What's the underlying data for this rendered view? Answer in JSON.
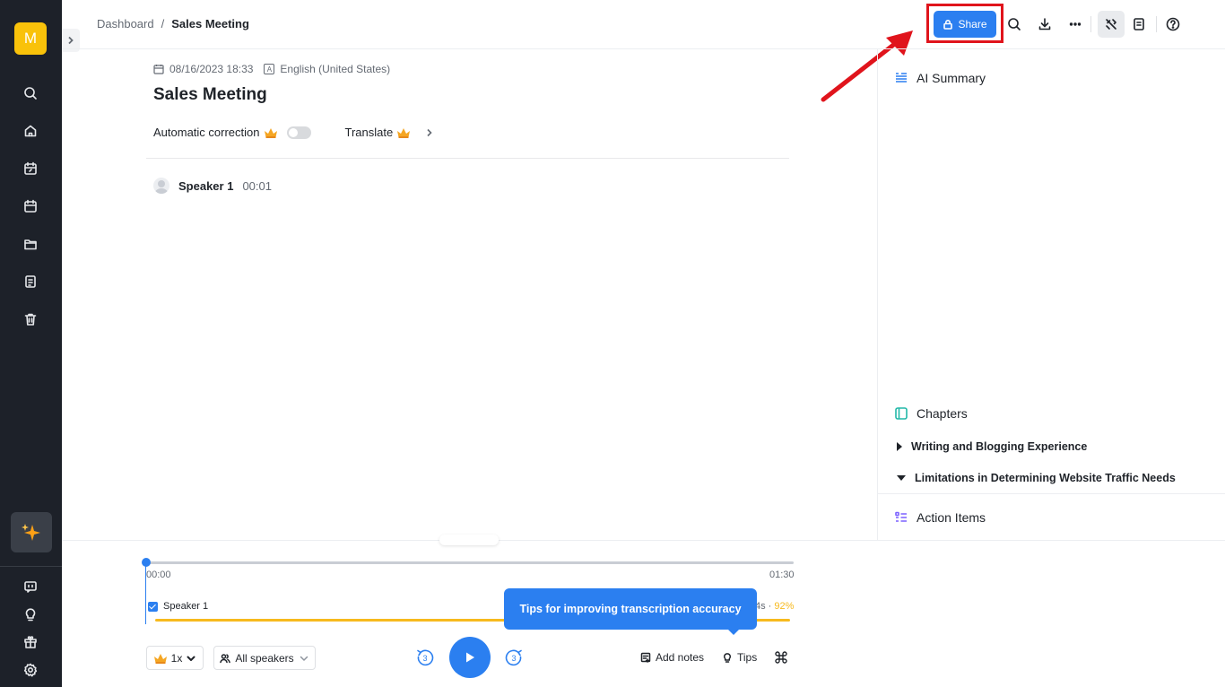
{
  "breadcrumb": {
    "parent": "Dashboard",
    "separator": "/",
    "current": "Sales Meeting"
  },
  "sidebar": {
    "avatar_letter": "M",
    "items": [
      "search-icon",
      "home-icon",
      "calendar-edit-icon",
      "calendar-icon",
      "folder-icon",
      "document-icon",
      "trash-icon"
    ],
    "bottom_items": [
      "feedback-icon",
      "lightbulb-icon",
      "gift-icon",
      "settings-icon"
    ]
  },
  "header": {
    "share_label": "Share",
    "icons": [
      "search-icon",
      "download-icon",
      "more-icon",
      "tools-icon",
      "notes-icon",
      "help-icon"
    ]
  },
  "doc": {
    "date": "08/16/2023 18:33",
    "lang_icon": "A",
    "language": "English (United States)",
    "title": "Sales Meeting",
    "auto_correction_label": "Automatic correction",
    "translate_label": "Translate",
    "speaker": {
      "name": "Speaker 1",
      "time": "00:01"
    }
  },
  "panel": {
    "ai_summary_title": "AI Summary",
    "chapters_title": "Chapters",
    "chapters": [
      {
        "title": "Writing and Blogging Experience",
        "expanded": false
      },
      {
        "title": "Limitations in Determining Website Traffic Needs",
        "expanded": true
      }
    ],
    "action_items_title": "Action Items"
  },
  "player": {
    "time_start": "00:00",
    "time_end": "01:30",
    "speaker_label": "Speaker 1",
    "speaker_stat_suffix": "4s · ",
    "speaker_pct": "92%",
    "tooltip": "Tips for improving transcription accuracy",
    "speed": "1x",
    "speakers_filter": "All speakers",
    "skip_seconds": "3",
    "add_notes": "Add notes",
    "tips": "Tips"
  },
  "colors": {
    "accent": "#2b7ff0",
    "highlight": "#e0141c",
    "sidebar": "#1d2129",
    "speaker_bar": "#f7ba1e"
  }
}
